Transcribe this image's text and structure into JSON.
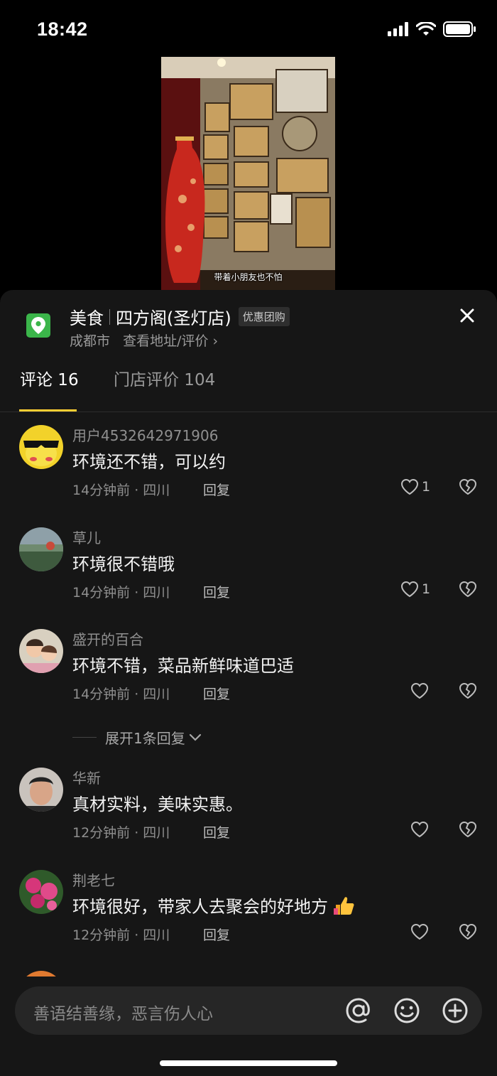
{
  "status_bar": {
    "time": "18:42"
  },
  "video": {
    "caption": "带着小朋友也不怕"
  },
  "poi": {
    "category": "美食",
    "name": "四方阁(圣灯店)",
    "badge": "优惠团购",
    "city": "成都市",
    "link": "查看地址/评价",
    "chevron": "›"
  },
  "tabs": [
    {
      "label": "评论 16",
      "active": true
    },
    {
      "label": "门店评价 104",
      "active": false
    }
  ],
  "comments": [
    {
      "user": "用户4532642971906",
      "text": "环境还不错，可以约",
      "meta": "14分钟前 · 四川",
      "reply": "回复",
      "likes": "1"
    },
    {
      "user": "草儿",
      "text": "环境很不错哦",
      "meta": "14分钟前 · 四川",
      "reply": "回复",
      "likes": "1"
    },
    {
      "user": "盛开的百合",
      "text": "环境不错，菜品新鲜味道巴适",
      "meta": "14分钟前 · 四川",
      "reply": "回复",
      "likes": ""
    },
    {
      "user": "华新",
      "text": "真材实料，美味实惠。",
      "meta": "12分钟前 · 四川",
      "reply": "回复",
      "likes": ""
    },
    {
      "user": "荆老七",
      "text": "环境很好，带家人去聚会的好地方",
      "meta": "12分钟前 · 四川",
      "reply": "回复",
      "likes": ""
    }
  ],
  "expand_replies": "展开1条回复",
  "input": {
    "placeholder": "善语结善缘，恶言伤人心"
  },
  "icons": {
    "location": "location-pin-icon",
    "close": "close-icon",
    "like": "heart-icon",
    "dislike": "broken-heart-icon",
    "mention": "at-icon",
    "emoji": "emoji-icon",
    "add": "plus-circle-icon"
  },
  "colors": {
    "accent": "#ffcf33",
    "poi_icon": "#3bb54a",
    "sheet_bg": "#161616"
  }
}
